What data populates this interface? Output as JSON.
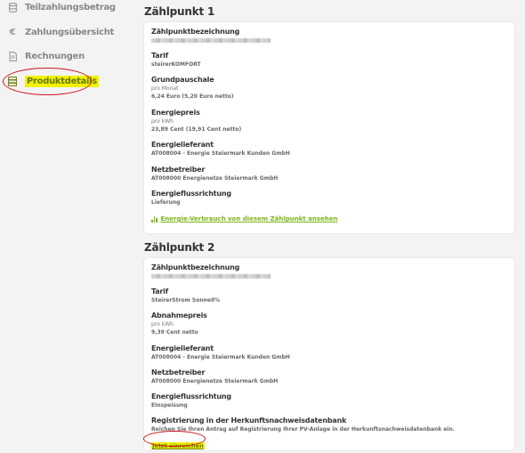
{
  "sidebar": {
    "items": [
      {
        "label": "Teilzahlungsbetrag",
        "icon": "database-icon"
      },
      {
        "label": "Zahlungsübersicht",
        "icon": "euro-icon"
      },
      {
        "label": "Rechnungen",
        "icon": "document-icon"
      },
      {
        "label": "Produktdetails",
        "icon": "list-icon",
        "active": true
      }
    ]
  },
  "zaehlpunkt1": {
    "title": "Zählpunkt 1",
    "bezeichnung_label": "Zählpunktbezeichnung",
    "tarif_label": "Tarif",
    "tarif_value": "steirerKOMFORT",
    "grundpauschale_label": "Grundpauschale",
    "grundpauschale_unit": "pro Monat",
    "grundpauschale_value": "6,24 Euro (5,20 Euro netto)",
    "energiepreis_label": "Energiepreis",
    "energiepreis_unit": "pro kWh",
    "energiepreis_value": "23,89 Cent (19,91 Cent netto)",
    "lieferant_label": "Energielieferant",
    "lieferant_value": "AT008004 - Energie Steiermark Kunden GmbH",
    "netzbetreiber_label": "Netzbetreiber",
    "netzbetreiber_value": "AT008000 Energienetze Steiermark GmbH",
    "richtung_label": "Energieflussrichtung",
    "richtung_value": "Lieferung",
    "verbrauch_link": "Energie-Verbrauch von diesem Zählpunkt ansehen"
  },
  "zaehlpunkt2": {
    "title": "Zählpunkt 2",
    "bezeichnung_label": "Zählpunktbezeichnung",
    "tarif_label": "Tarif",
    "tarif_value": "SteirerStrom Sonne0%",
    "abnahmepreis_label": "Abnahmepreis",
    "abnahmepreis_unit": "pro kWh",
    "abnahmepreis_value": "9,39 Cent netto",
    "lieferant_label": "Energielieferant",
    "lieferant_value": "AT008004 - Energie Steiermark Kunden GmbH",
    "netzbetreiber_label": "Netzbetreiber",
    "netzbetreiber_value": "AT008000 Energienetze Steiermark GmbH",
    "richtung_label": "Energieflussrichtung",
    "richtung_value": "Einspeisung",
    "registrierung_label": "Registrierung in der Herkunftsnachweisdatenbank",
    "registrierung_text": "Reichen Sie Ihren Antrag auf Registrierung Ihrer PV-Anlage in der Herkunftsnachweisdatenbank ein.",
    "einreichen_link": "Jetzt einreichen"
  },
  "colors": {
    "accent_green": "#7cb518",
    "highlight_yellow": "#f0f200",
    "annotation_red": "#d0161b"
  }
}
